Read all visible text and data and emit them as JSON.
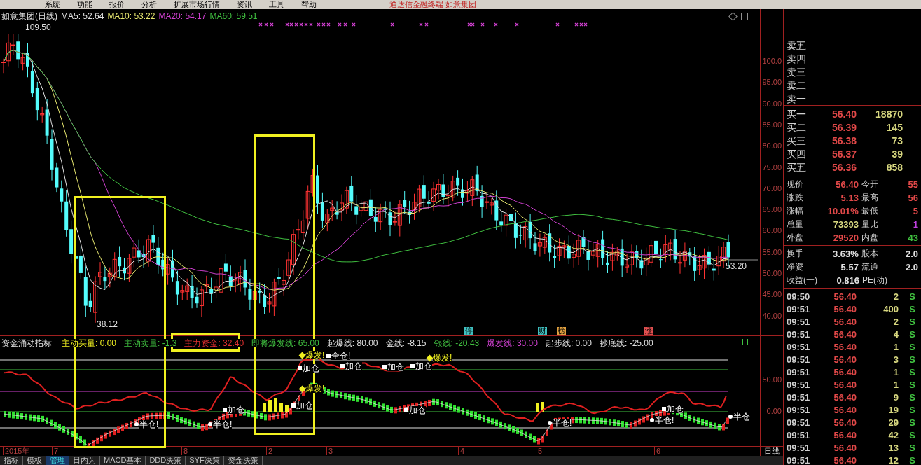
{
  "menu_bar": {
    "items": [
      "系统",
      "功能",
      "报价",
      "分析",
      "扩展市场行情",
      "资讯",
      "工具",
      "帮助"
    ],
    "title": "通达信金融终端 如意集团"
  },
  "price_chart": {
    "legend": [
      {
        "label": "如意集团(日线)",
        "color": "#e0e0e0"
      },
      {
        "label": "MA5: 52.64",
        "color": "#e0e0e0"
      },
      {
        "label": "MA10: 53.22",
        "color": "#e8e870"
      },
      {
        "label": "MA20: 54.17",
        "color": "#d040d0"
      },
      {
        "label": "MA60: 59.51",
        "color": "#40c040"
      }
    ],
    "annotations": [
      "109.50",
      "38.12",
      "53.20"
    ],
    "event_marks": [
      {
        "text": "停",
        "color": "#40c0c0"
      },
      {
        "text": "财",
        "color": "#40c0c0"
      },
      {
        "text": "榜",
        "color": "#e0a040"
      },
      {
        "text": "涨",
        "color": "#e05050"
      }
    ],
    "axis_labels": [
      "100.0",
      "95.00",
      "90.00",
      "85.00",
      "80.00",
      "75.00",
      "70.00",
      "65.00",
      "60.00",
      "55.00",
      "50.00",
      "45.00",
      "40.00"
    ]
  },
  "indicator": {
    "title": "资金涌动指标",
    "legend": [
      {
        "label": "主动买量: 0.00",
        "color": "#f0f020"
      },
      {
        "label": "主动卖量: -1.3",
        "color": "#40c040"
      },
      {
        "label": "主力资金: 32.40",
        "color": "#e03030"
      },
      {
        "label": "即将爆发线: 65.00",
        "color": "#40c040"
      },
      {
        "label": "起爆线: 80.00",
        "color": "#e0e0e0"
      },
      {
        "label": "金线: -8.15",
        "color": "#e0e0e0"
      },
      {
        "label": "银线: -20.43",
        "color": "#40c040"
      },
      {
        "label": "爆发线: 30.00",
        "color": "#d040d0"
      },
      {
        "label": "起步线: 0.00",
        "color": "#e0e0e0"
      },
      {
        "label": "抄底线: -25.00",
        "color": "#e0e0e0"
      }
    ],
    "signals": [
      {
        "text": "爆发!",
        "kind": "burst"
      },
      {
        "text": "全仓!",
        "kind": "add"
      },
      {
        "text": "加仓",
        "kind": "add"
      },
      {
        "text": "加仓",
        "kind": "add"
      },
      {
        "text": "加仓",
        "kind": "add"
      },
      {
        "text": "加仓",
        "kind": "add"
      },
      {
        "text": "爆发!",
        "kind": "burst"
      },
      {
        "text": "爆发!",
        "kind": "burst"
      },
      {
        "text": "加仓",
        "kind": "add"
      },
      {
        "text": "加仓",
        "kind": "add"
      },
      {
        "text": "半仓!",
        "kind": "half"
      },
      {
        "text": "半仓!",
        "kind": "half"
      },
      {
        "text": "加仓",
        "kind": "add"
      },
      {
        "text": "半仓!",
        "kind": "half"
      },
      {
        "text": "半仓!",
        "kind": "half"
      },
      {
        "text": "加仓",
        "kind": "add"
      },
      {
        "text": "半仓",
        "kind": "half"
      }
    ],
    "axis_labels": [
      "50.00",
      "0.00"
    ]
  },
  "date_axis": [
    "2015年",
    "7",
    "8",
    "2",
    "3",
    "4",
    "5",
    "6"
  ],
  "period_label": "日线",
  "bottom_tabs": [
    {
      "label": "指标",
      "selected": false
    },
    {
      "label": "模板",
      "selected": false
    },
    {
      "label": "管理",
      "selected": true
    },
    {
      "label": "日内为",
      "selected": false
    },
    {
      "label": "MACD基本",
      "selected": false
    },
    {
      "label": "DDD决策",
      "selected": false
    },
    {
      "label": "SYF决策",
      "selected": false
    },
    {
      "label": "资金决策",
      "selected": false
    }
  ],
  "order_book": {
    "asks": [
      "卖五",
      "卖四",
      "卖三",
      "卖二",
      "卖一"
    ],
    "bids": [
      {
        "label": "买一",
        "price": "56.40",
        "volume": "18870"
      },
      {
        "label": "买二",
        "price": "56.39",
        "volume": "145"
      },
      {
        "label": "买三",
        "price": "56.38",
        "volume": "73"
      },
      {
        "label": "买四",
        "price": "56.37",
        "volume": "39"
      },
      {
        "label": "买五",
        "price": "56.36",
        "volume": "858"
      }
    ]
  },
  "quote_stats": [
    [
      {
        "label": "现价",
        "value": "56.40",
        "color": "#e04848"
      },
      {
        "label": "今开",
        "value": "55",
        "color": "#e04848"
      }
    ],
    [
      {
        "label": "涨跌",
        "value": "5.13",
        "color": "#e04848"
      },
      {
        "label": "最高",
        "value": "56",
        "color": "#e04848"
      }
    ],
    [
      {
        "label": "涨幅",
        "value": "10.01%",
        "color": "#e04848"
      },
      {
        "label": "最低",
        "value": "5",
        "color": "#e04848"
      }
    ],
    [
      {
        "label": "总量",
        "value": "73393",
        "color": "#d8d880"
      },
      {
        "label": "量比",
        "value": "1",
        "color": "#c040e0"
      }
    ],
    [
      {
        "label": "外盘",
        "value": "29520",
        "color": "#e04848"
      },
      {
        "label": "内盘",
        "value": "43",
        "color": "#40c040"
      }
    ]
  ],
  "company_stats": [
    [
      {
        "label": "换手",
        "value": "3.63%"
      },
      {
        "label": "股本",
        "value": "2.0"
      }
    ],
    [
      {
        "label": "净资",
        "value": "5.57"
      },
      {
        "label": "流通",
        "value": "2.0"
      }
    ],
    [
      {
        "label": "收益(一)",
        "value": "0.816"
      },
      {
        "label": "PE(动)"
      }
    ]
  ],
  "ticks": [
    {
      "time": "09:50",
      "price": "56.40",
      "volume": "2",
      "side": "S"
    },
    {
      "time": "09:51",
      "price": "56.40",
      "volume": "400",
      "side": "S"
    },
    {
      "time": "09:51",
      "price": "56.40",
      "volume": "2",
      "side": "S"
    },
    {
      "time": "09:51",
      "price": "56.40",
      "volume": "4",
      "side": "S"
    },
    {
      "time": "09:51",
      "price": "56.40",
      "volume": "1",
      "side": "S"
    },
    {
      "time": "09:51",
      "price": "56.40",
      "volume": "3",
      "side": "S"
    },
    {
      "time": "09:51",
      "price": "56.40",
      "volume": "1",
      "side": "S"
    },
    {
      "time": "09:51",
      "price": "56.40",
      "volume": "1",
      "side": "S"
    },
    {
      "time": "09:51",
      "price": "56.40",
      "volume": "9",
      "side": "S"
    },
    {
      "time": "09:51",
      "price": "56.40",
      "volume": "19",
      "side": "S"
    },
    {
      "time": "09:51",
      "price": "56.40",
      "volume": "29",
      "side": "S"
    },
    {
      "time": "09:51",
      "price": "56.40",
      "volume": "42",
      "side": "S"
    },
    {
      "time": "09:51",
      "price": "56.40",
      "volume": "13",
      "side": "S"
    },
    {
      "time": "09:51",
      "price": "56.40",
      "volume": "12",
      "side": "S"
    }
  ]
}
